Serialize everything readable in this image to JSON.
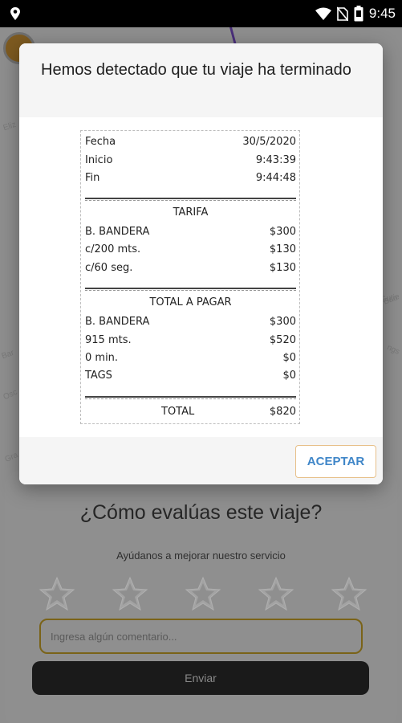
{
  "status_bar": {
    "time": "9:45"
  },
  "map": {
    "street_labels": [
      "Eliz",
      "Gutie",
      "Bao",
      "Bar",
      "Osc",
      "Gra",
      "ngs"
    ]
  },
  "rating": {
    "title": "¿Cómo evalúas este viaje?",
    "subtitle": "Ayúdanos a mejorar nuestro servicio",
    "stars_total": 5,
    "comment_placeholder": "Ingresa algún comentario...",
    "send_label": "Enviar"
  },
  "dialog": {
    "title": "Hemos detectado que tu viaje ha terminado",
    "accept_label": "ACEPTAR",
    "receipt": {
      "trip": [
        {
          "label": "Fecha",
          "value": "30/5/2020"
        },
        {
          "label": "Inicio",
          "value": "9:43:39"
        },
        {
          "label": "Fin",
          "value": "9:44:48"
        }
      ],
      "tariff_heading": "TARIFA",
      "tariff": [
        {
          "label": "B. BANDERA",
          "value": "$300"
        },
        {
          "label": "c/200 mts.",
          "value": "$130"
        },
        {
          "label": "c/60 seg.",
          "value": "$130"
        }
      ],
      "payable_heading": "TOTAL A PAGAR",
      "payable": [
        {
          "label": "B. BANDERA",
          "value": "$300"
        },
        {
          "label": "915 mts.",
          "value": "$520"
        },
        {
          "label": "0 min.",
          "value": "$0"
        },
        {
          "label": "TAGS",
          "value": "$0"
        }
      ],
      "total": {
        "label": "TOTAL",
        "value": "$820"
      }
    }
  },
  "colors": {
    "accent_blue": "#3f86c8",
    "accent_border": "#e7c08a",
    "overlay": "#9a9a9a"
  }
}
